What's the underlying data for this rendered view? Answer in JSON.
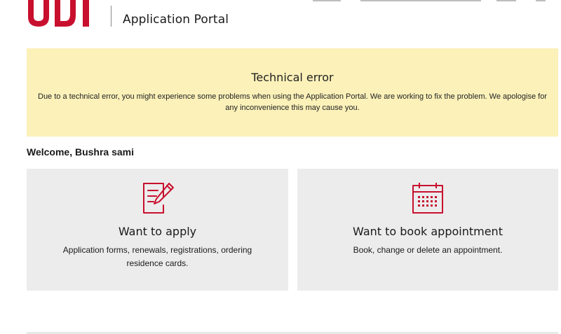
{
  "header": {
    "portal_title": "Application Portal"
  },
  "alert": {
    "title": "Technical error",
    "message": "Due to a technical error, you might experience some problems when using the Application Portal. We are working to fix the problem. We apologise for any inconvenience this may cause you."
  },
  "welcome": "Welcome, Bushra sami",
  "cards": [
    {
      "icon": "form-edit-icon",
      "title": "Want to apply",
      "description": "Application forms, renewals, registrations, ordering residence cards."
    },
    {
      "icon": "calendar-icon",
      "title": "Want to book appointment",
      "description": "Book, change or delete an appointment."
    }
  ],
  "colors": {
    "brand_red": "#c8102e",
    "alert_background": "#fbf1b9",
    "card_background": "#ececec"
  }
}
